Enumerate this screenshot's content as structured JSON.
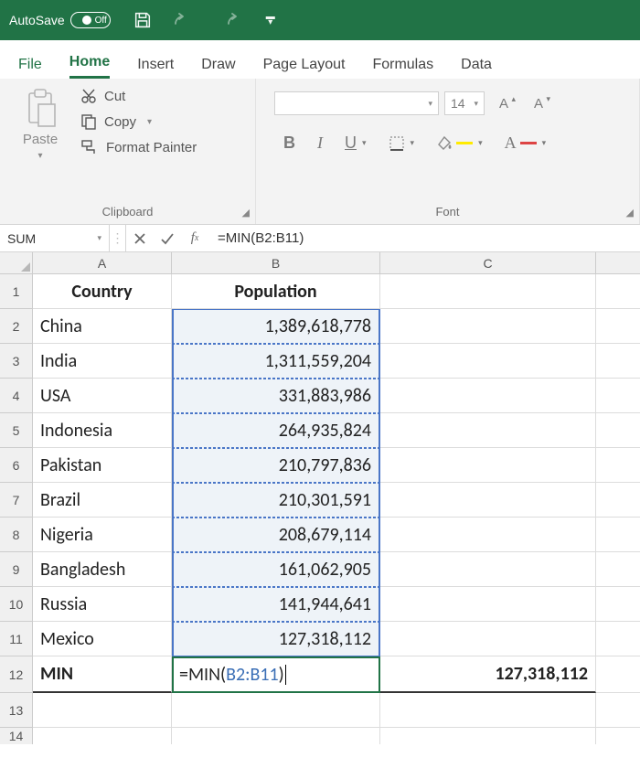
{
  "titlebar": {
    "autosave_label": "AutoSave",
    "autosave_state": "Off"
  },
  "tabs": {
    "file": "File",
    "home": "Home",
    "insert": "Insert",
    "draw": "Draw",
    "page_layout": "Page Layout",
    "formulas": "Formulas",
    "data": "Data"
  },
  "ribbon": {
    "clipboard": {
      "paste": "Paste",
      "cut": "Cut",
      "copy": "Copy",
      "format_painter": "Format Painter",
      "group_label": "Clipboard"
    },
    "font": {
      "size": "14",
      "bold": "B",
      "italic": "I",
      "underline": "U",
      "inc": "A",
      "dec": "A",
      "group_label": "Font"
    }
  },
  "namebox": "SUM",
  "formula_bar": "=MIN(B2:B11)",
  "columns": {
    "A": "A",
    "B": "B",
    "C": "C"
  },
  "headers": {
    "country": "Country",
    "population": "Population"
  },
  "rows": [
    {
      "n": "1"
    },
    {
      "n": "2",
      "country": "China",
      "pop": "1,389,618,778"
    },
    {
      "n": "3",
      "country": "India",
      "pop": "1,311,559,204"
    },
    {
      "n": "4",
      "country": "USA",
      "pop": "331,883,986"
    },
    {
      "n": "5",
      "country": "Indonesia",
      "pop": "264,935,824"
    },
    {
      "n": "6",
      "country": "Pakistan",
      "pop": "210,797,836"
    },
    {
      "n": "7",
      "country": "Brazil",
      "pop": "210,301,591"
    },
    {
      "n": "8",
      "country": "Nigeria",
      "pop": "208,679,114"
    },
    {
      "n": "9",
      "country": "Bangladesh",
      "pop": "161,062,905"
    },
    {
      "n": "10",
      "country": "Russia",
      "pop": "141,944,641"
    },
    {
      "n": "11",
      "country": "Mexico",
      "pop": "127,318,112"
    },
    {
      "n": "12",
      "country": "MIN"
    },
    {
      "n": "13"
    },
    {
      "n": "14"
    }
  ],
  "edit_cell": {
    "prefix": "=MIN(",
    "ref": "B2:B11",
    "suffix": ")"
  },
  "result_c12": "127,318,112"
}
